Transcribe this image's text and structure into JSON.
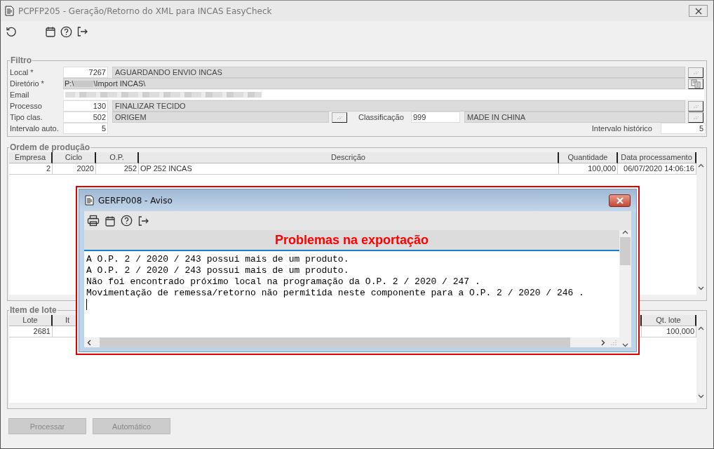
{
  "window": {
    "title": "PCPFP205 - Geração/Retorno do XML para INCAS EasyCheck"
  },
  "filter": {
    "legend": "Filtro",
    "local": {
      "label": "Local *",
      "code": "7267",
      "description": "AGUARDANDO ENVIO INCAS"
    },
    "directory": {
      "label": "Diretório *",
      "value_start": "P:\\",
      "value_end": "\\Import INCAS\\"
    },
    "email": {
      "label": "Email"
    },
    "process": {
      "label": "Processo",
      "code": "130",
      "description": "FINALIZAR TECIDO"
    },
    "class_type": {
      "label": "Tipo clas.",
      "code": "502",
      "description": "ORIGEM"
    },
    "classification": {
      "label": "Classificação",
      "code": "999",
      "description": "MADE IN CHINA"
    },
    "auto_interval": {
      "label": "Intervalo auto.",
      "value": "5"
    },
    "history_interval": {
      "label": "Intervalo histórico",
      "value": "5"
    }
  },
  "orders": {
    "legend": "Ordem de produção",
    "columns": [
      "Empresa",
      "Ciclo",
      "O.P.",
      "Descrição",
      "Quantidade",
      "Data processamento"
    ],
    "rows": [
      [
        "2",
        "2020",
        "252",
        "OP 252 INCAS",
        "100,000",
        "06/07/2020 14:06:16"
      ]
    ]
  },
  "lots": {
    "legend": "Item de lote",
    "columns": [
      "Lote",
      "It",
      "Qt. lote"
    ],
    "rows": [
      {
        "lote": "2681",
        "qt_lote": "100,000"
      }
    ]
  },
  "buttons": [
    {
      "label": "Processar",
      "disabled": true
    },
    {
      "label": "Automático",
      "disabled": true
    }
  ],
  "dialog": {
    "title": "GERFP008 - Aviso",
    "heading": "Problemas na exportação",
    "lines": [
      "A O.P. 2 / 2020 / 243 possui mais de um produto.",
      "A O.P. 2 / 2020 / 243 possui mais de um produto.",
      "Não foi encontrado próximo local na programação da O.P. 2 / 2020 / 247 .",
      "Movimentação de remessa/retorno não permitida neste componente para a O.P. 2 / 2020 / 246 ."
    ]
  }
}
